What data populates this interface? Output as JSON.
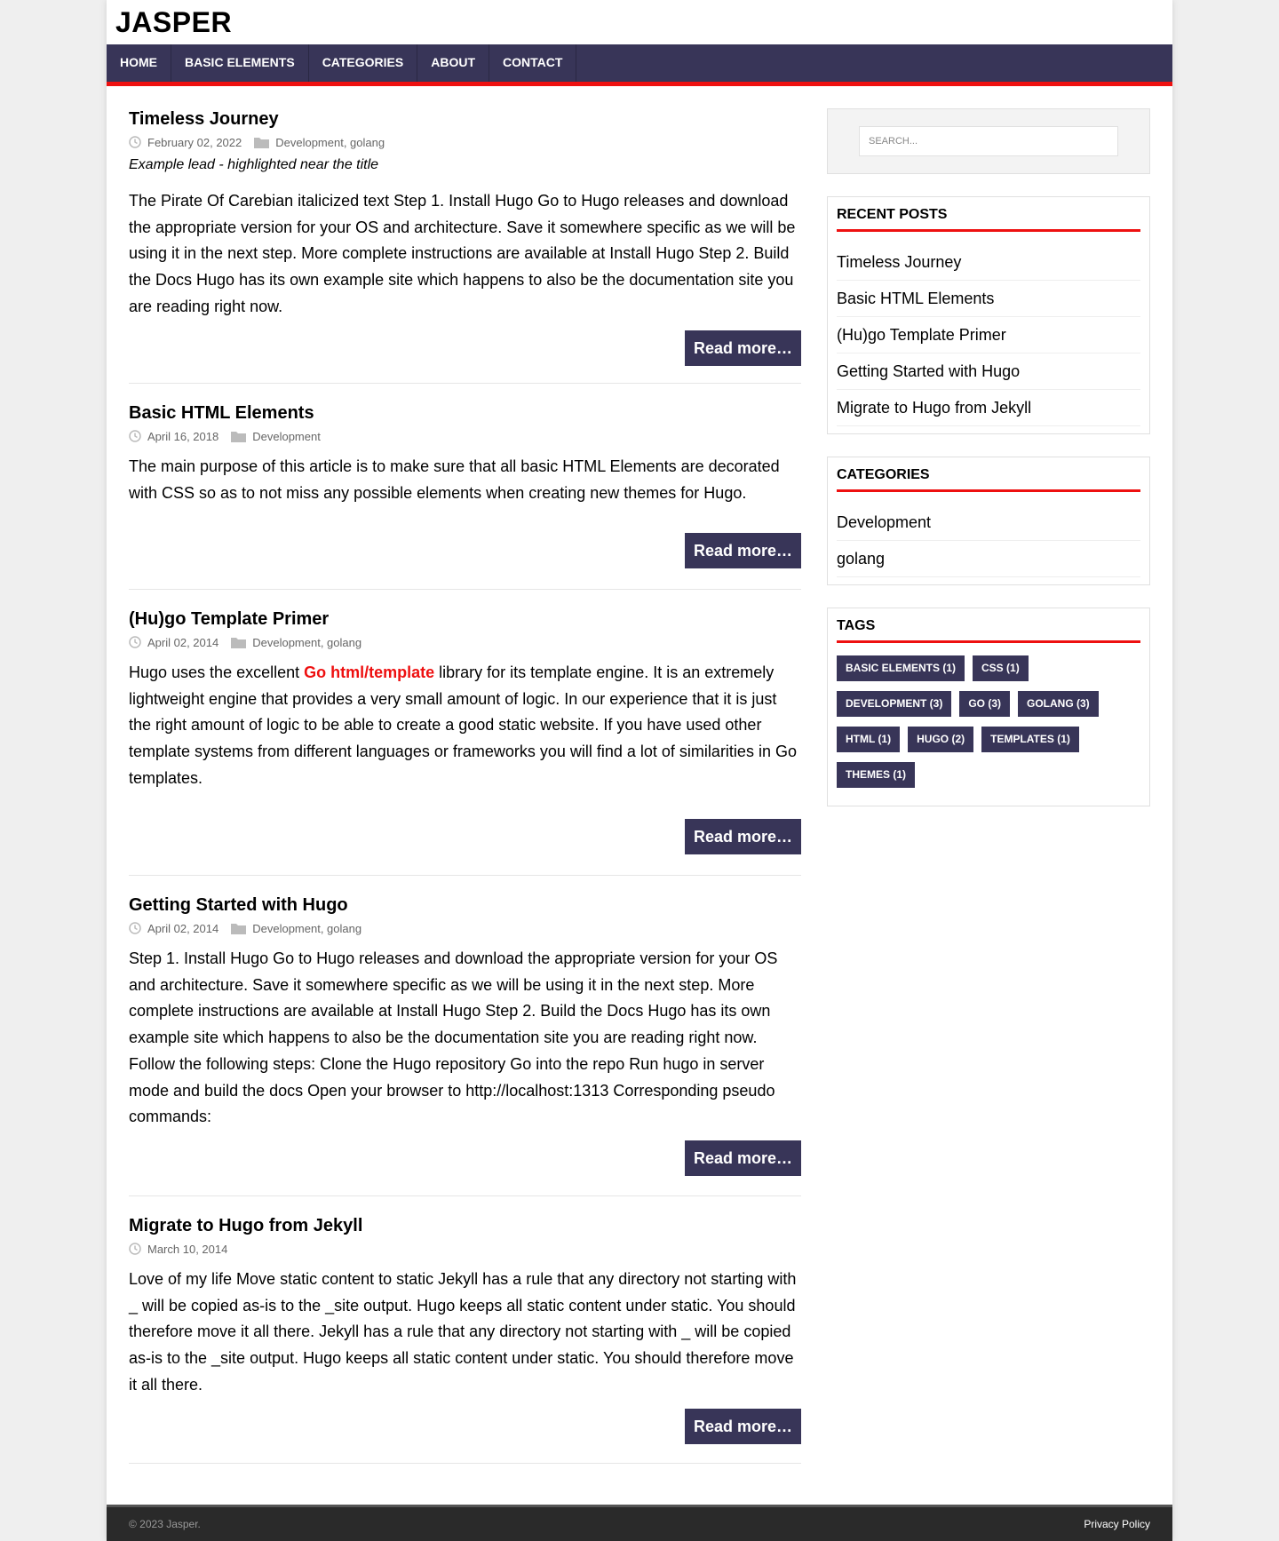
{
  "site": {
    "title": "JASPER"
  },
  "nav": [
    "HOME",
    "BASIC ELEMENTS",
    "CATEGORIES",
    "ABOUT",
    "CONTACT"
  ],
  "posts": [
    {
      "title": "Timeless Journey",
      "date": "February 02, 2022",
      "categories": "Development, golang",
      "lead": "Example lead - highlighted near the title",
      "excerpt": "The Pirate Of Carebian italicized text Step 1. Install Hugo Go to Hugo releases and download the appropriate version for your OS and architecture. Save it somewhere specific as we will be using it in the next step. More complete instructions are available at Install Hugo Step 2. Build the Docs Hugo has its own example site which happens to also be the documentation site you are reading right now.",
      "read_more": "Read more…"
    },
    {
      "title": "Basic HTML Elements",
      "date": "April 16, 2018",
      "categories": "Development",
      "excerpt": "The main purpose of this article is to make sure that all basic HTML Elements are decorated with CSS so as to not miss any possible elements when creating new themes for Hugo.",
      "read_more": "Read more…"
    },
    {
      "title": "(Hu)go Template Primer",
      "date": "April 02, 2014",
      "categories": "Development, golang",
      "excerpt_before": "Hugo uses the excellent ",
      "excerpt_link": "Go html/template",
      "excerpt_after": " library for its template engine. It is an extremely lightweight engine that provides a very small amount of logic. In our experience that it is just the right amount of logic to be able to create a good static website. If you have used other template systems from different languages or frameworks you will find a lot of similarities in Go templates.",
      "read_more": "Read more…"
    },
    {
      "title": "Getting Started with Hugo",
      "date": "April 02, 2014",
      "categories": "Development, golang",
      "excerpt": "Step 1. Install Hugo Go to Hugo releases and download the appropriate version for your OS and architecture. Save it somewhere specific as we will be using it in the next step. More complete instructions are available at Install Hugo Step 2. Build the Docs Hugo has its own example site which happens to also be the documentation site you are reading right now. Follow the following steps: Clone the Hugo repository Go into the repo Run hugo in server mode and build the docs Open your browser to http://localhost:1313 Corresponding pseudo commands:",
      "read_more": "Read more…"
    },
    {
      "title": "Migrate to Hugo from Jekyll",
      "date": "March 10, 2014",
      "excerpt": "Love of my life Move static content to static Jekyll has a rule that any directory not starting with _ will be copied as-is to the _site output. Hugo keeps all static content under static. You should therefore move it all there. Jekyll has a rule that any directory not starting with _ will be copied as-is to the _site output. Hugo keeps all static content under static. You should therefore move it all there.",
      "read_more": "Read more…"
    }
  ],
  "sidebar": {
    "search_placeholder": "SEARCH...",
    "recent_title": "RECENT POSTS",
    "recent": [
      "Timeless Journey",
      "Basic HTML Elements",
      "(Hu)go Template Primer",
      "Getting Started with Hugo",
      "Migrate to Hugo from Jekyll"
    ],
    "categories_title": "CATEGORIES",
    "categories": [
      "Development",
      "golang"
    ],
    "tags_title": "TAGS",
    "tags": [
      "BASIC ELEMENTS (1)",
      "CSS (1)",
      "DEVELOPMENT (3)",
      "GO (3)",
      "GOLANG (3)",
      "HTML (1)",
      "HUGO (2)",
      "TEMPLATES (1)",
      "THEMES (1)"
    ]
  },
  "footer": {
    "copyright": "© 2023 Jasper.",
    "privacy": "Privacy Policy"
  },
  "colors": {
    "accent": "#ee1010",
    "nav": "#383558",
    "footer": "#2a2a2a"
  }
}
